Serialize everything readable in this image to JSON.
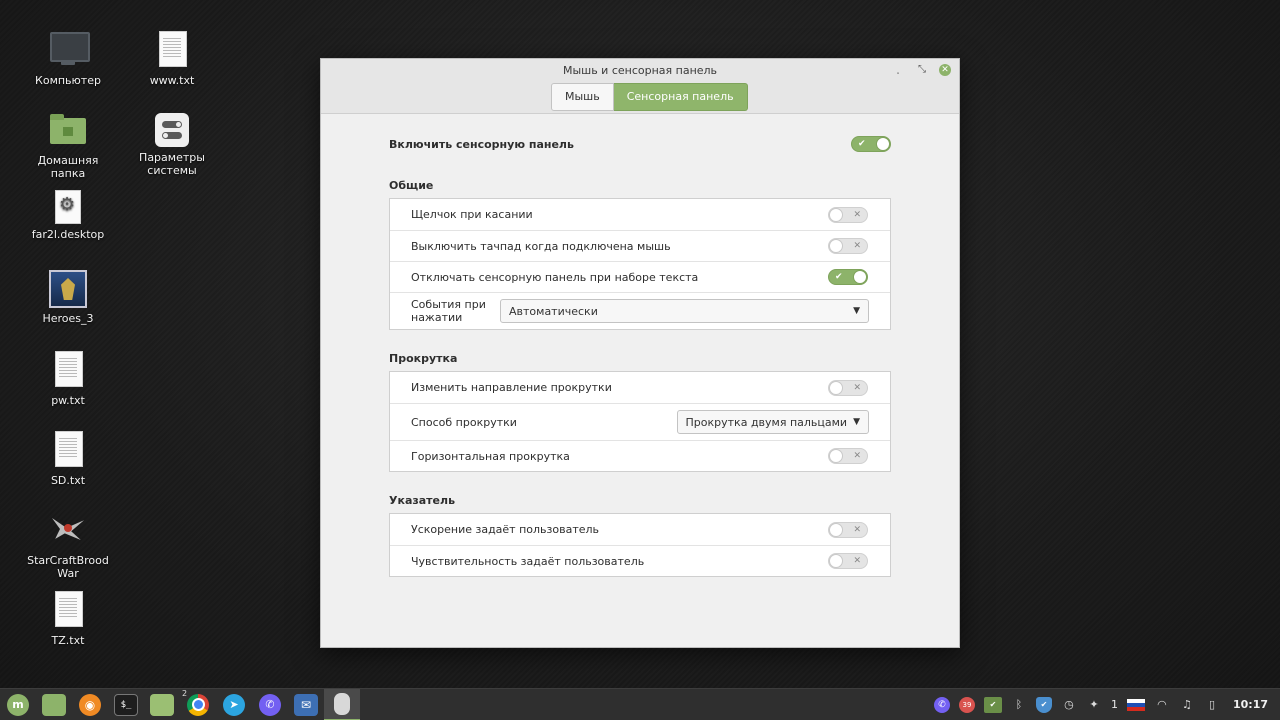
{
  "desktop": {
    "icons": [
      {
        "label": "Компьютер"
      },
      {
        "label": "www.txt"
      },
      {
        "label": "Домашняя папка"
      },
      {
        "label": "Параметры системы"
      },
      {
        "label": "far2l.desktop"
      },
      {
        "label": "Heroes_3"
      },
      {
        "label": "pw.txt"
      },
      {
        "label": "SD.txt"
      },
      {
        "label": "StarCraftBroodWar"
      },
      {
        "label": "TZ.txt"
      }
    ]
  },
  "window": {
    "title": "Мышь и сенсорная панель",
    "tabs": [
      {
        "label": "Мышь",
        "active": false
      },
      {
        "label": "Сенсорная панель",
        "active": true
      }
    ],
    "enable_touchpad": {
      "label": "Включить сенсорную панель",
      "on": true
    },
    "sections": {
      "general": {
        "title": "Общие",
        "tap_click": {
          "label": "Щелчок при касании",
          "on": false
        },
        "disable_with_mouse": {
          "label": "Выключить тачпад когда подключена мышь",
          "on": false
        },
        "disable_while_typing": {
          "label": "Отключать сенсорную панель при наборе текста",
          "on": true
        },
        "click_events": {
          "label": "События при нажатии",
          "value": "Автоматически"
        }
      },
      "scrolling": {
        "title": "Прокрутка",
        "reverse": {
          "label": "Изменить направление прокрутки",
          "on": false
        },
        "method": {
          "label": "Способ прокрутки",
          "value": "Прокрутка двумя пальцами"
        },
        "horizontal": {
          "label": "Горизонтальная прокрутка",
          "on": false
        }
      },
      "pointer": {
        "title": "Указатель",
        "custom_accel": {
          "label": "Ускорение задаёт пользователь",
          "on": false
        },
        "custom_speed": {
          "label": "Чувствительность задаёт пользователь",
          "on": false
        }
      }
    }
  },
  "taskbar": {
    "launcher_badge": "2",
    "tray_badge": "39",
    "notification_count": "1",
    "clock": "10:17"
  },
  "colors": {
    "accent": "#8db36a",
    "window_bg": "#f0f0f0",
    "taskbar_bg": "#2f2f2f"
  },
  "icons": {
    "switch_on_mark": "✔",
    "switch_off_mark": "✕",
    "dropdown_arrow": "▼"
  }
}
